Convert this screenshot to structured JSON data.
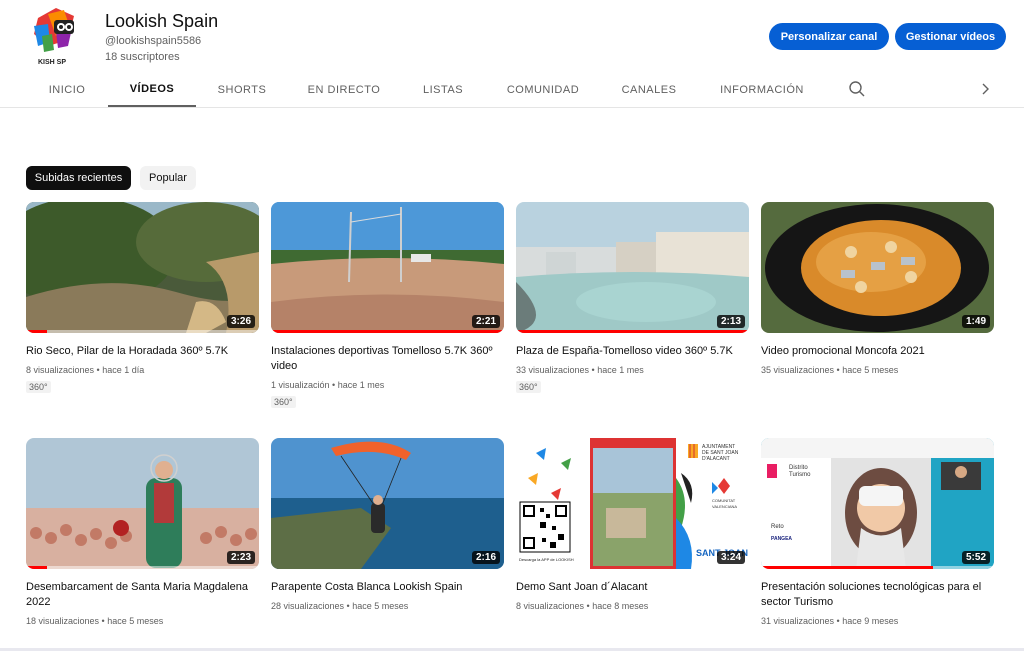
{
  "channel": {
    "name": "Lookish Spain",
    "handle": "@lookishspain5586",
    "subscribers": "18 suscriptores",
    "logo_text": "KISH SP"
  },
  "actions": {
    "customize": "Personalizar canal",
    "manage": "Gestionar vídeos"
  },
  "tabs": [
    "INICIO",
    "VÍDEOS",
    "SHORTS",
    "EN DIRECTO",
    "LISTAS",
    "COMUNIDAD",
    "CANALES",
    "INFORMACIÓN"
  ],
  "active_tab": "VÍDEOS",
  "chips": [
    "Subidas recientes",
    "Popular"
  ],
  "videos": [
    {
      "title": "Rio Seco, Pilar de la Horadada 360º 5.7K",
      "views": "8 visualizaciones",
      "age": "hace 1 día",
      "duration": "3:26",
      "badge": "360°",
      "progress": 0.09
    },
    {
      "title": "Instalaciones deportivas Tomelloso 5.7K 360º video",
      "views": "1 visualización",
      "age": "hace 1 mes",
      "duration": "2:21",
      "badge": "360°",
      "progress": 1.0
    },
    {
      "title": "Plaza de España-Tomelloso video 360º 5.7K",
      "views": "33 visualizaciones",
      "age": "hace 1 mes",
      "duration": "2:13",
      "badge": "360°",
      "progress": 1.0
    },
    {
      "title": "Video promocional Moncofa 2021",
      "views": "35 visualizaciones",
      "age": "hace 5 meses",
      "duration": "1:49",
      "badge": "",
      "progress": 0
    },
    {
      "title": "Desembarcament de Santa Maria Magdalena 2022",
      "views": "18 visualizaciones",
      "age": "hace 5 meses",
      "duration": "2:23",
      "badge": "",
      "progress": 0.09
    },
    {
      "title": "Parapente Costa Blanca Lookish Spain",
      "views": "28 visualizaciones",
      "age": "hace 5 meses",
      "duration": "2:16",
      "badge": "",
      "progress": 0
    },
    {
      "title": "Demo Sant Joan d´Alacant",
      "views": "8 visualizaciones",
      "age": "hace 8 meses",
      "duration": "3:24",
      "badge": "",
      "progress": 0
    },
    {
      "title": "Presentación soluciones tecnológicas para el sector Turismo",
      "views": "31 visualizaciones",
      "age": "hace 9 meses",
      "duration": "5:52",
      "badge": "",
      "progress": 0.74
    }
  ],
  "thumb_text": {
    "demo_left_title": "Descarga la APP de LOOKISH",
    "demo_right_1": "AJUNTAMENT",
    "demo_right_2": "DE SANT JOAN",
    "demo_right_3": "D'ALACANT",
    "demo_comunitat_1": "COMUNITAT",
    "demo_comunitat_2": "VALENCIANA",
    "demo_santjoan": "SANT JOAN",
    "turismo_1": "Distrito",
    "turismo_2": "Turismo",
    "turismo_reto": "Reto",
    "turismo_pangea": "PANGEA"
  },
  "colors": {
    "accent_blue": "#065fd4",
    "progress_red": "#ff0000",
    "text_primary": "#0f0f0f",
    "text_secondary": "#606060"
  },
  "icons": {
    "search": "search-icon",
    "next": "chevron-right-icon"
  }
}
